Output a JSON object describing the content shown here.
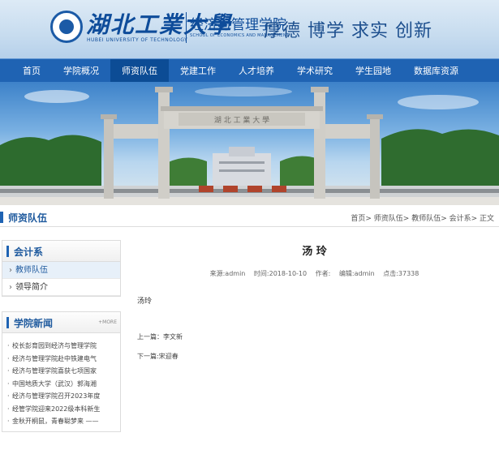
{
  "header": {
    "university_cn": "湖北工業大學",
    "university_en": "HUBEI UNIVERSITY OF TECHNOLOGY",
    "school_cn": "经济与管理学院",
    "school_en": "SCHOOL OF ECONOMICS AND MANAGEMENT",
    "motto": "厚德  博学  求实  创新"
  },
  "nav": {
    "items": [
      "首页",
      "学院概况",
      "师资队伍",
      "党建工作",
      "人才培养",
      "学术研究",
      "学生园地",
      "数据库资源"
    ],
    "active_index": 2
  },
  "banner": {
    "gate_inscription": "湖 北 工 業 大 學"
  },
  "subheader": {
    "title": "师资队伍",
    "breadcrumb": "首页> 师资队伍> 教师队伍> 会计系> 正文"
  },
  "sidebar": {
    "dept_title": "会计系",
    "items": [
      "教师队伍",
      "领导简介"
    ],
    "active_index": 0,
    "news_title": "学院新闻",
    "news_more": "+MORE",
    "news": [
      "校长彭育园到经济与管理学院",
      "经济与管理学院赴中铁建电气",
      "经济与管理学院喜获七项国家",
      "中国地质大学（武汉）郭海湘",
      "经济与管理学院召开2023年度",
      "经管学院迎来2022级本科新生",
      "金秋开桐鼠，青春聪梦来 ——"
    ]
  },
  "article": {
    "title": "汤 玲",
    "source": "来源:admin",
    "time": "时间:2018-10-10",
    "author": "作者:",
    "editor": "编辑:admin",
    "clicks": "点击:37338",
    "body": "汤玲",
    "prev": "上一篇：李文新",
    "next": "下一篇:宋迎春"
  },
  "colors": {
    "nav_blue": "#1f63b3",
    "nav_active": "#0c4c95",
    "accent_text": "#1f5a9e"
  }
}
